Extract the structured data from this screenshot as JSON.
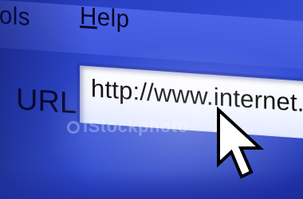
{
  "menubar": {
    "items": [
      {
        "label": "ools"
      },
      {
        "label_mnemonic": "H",
        "label_rest": "elp"
      }
    ]
  },
  "address_bar": {
    "label": "URL:",
    "value": "http://www.internet.com"
  },
  "watermark": {
    "text": "iStockphoto"
  },
  "cursor": {
    "icon": "arrow-pointer-icon"
  },
  "colors": {
    "screen_blue": "#2f49d0",
    "text": "#06082a",
    "field_bg": "#ffffff"
  }
}
